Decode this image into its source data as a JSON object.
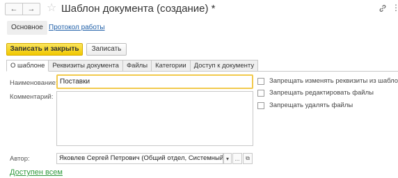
{
  "header": {
    "back_glyph": "←",
    "forward_glyph": "→",
    "star_glyph": "☆",
    "title": "Шаблон документа (создание) *",
    "more_glyph": "⋮"
  },
  "nav_tabs": {
    "main": "Основное",
    "protocol": "Протокол работы"
  },
  "toolbar": {
    "save_close": "Записать и закрыть",
    "save": "Записать"
  },
  "tabs": [
    "О шаблоне",
    "Реквизиты документа",
    "Файлы",
    "Категории",
    "Доступ к документу"
  ],
  "form": {
    "name_label": "Наименование:",
    "name_value": "Поставки",
    "comment_label": "Комментарий:",
    "author_label": "Автор:",
    "author_value": "Яковлев Сергей Петрович (Общий отдел, Системный ад",
    "author_dropdown_glyph": "▾",
    "author_more_glyph": "...",
    "author_open_glyph": "⧉"
  },
  "checkboxes": [
    {
      "label": "Запрещать изменять реквизиты из шаблона",
      "checked": false
    },
    {
      "label": "Запрещать редактировать файлы",
      "checked": false
    },
    {
      "label": "Запрещать удалять файлы",
      "checked": false
    }
  ],
  "footer": {
    "access_link": "Доступен всем"
  },
  "colors": {
    "primary_button": "#f1c800",
    "link": "#1f5fa8",
    "access_link": "#2e9a3c",
    "focus_border": "#f2c94c"
  }
}
